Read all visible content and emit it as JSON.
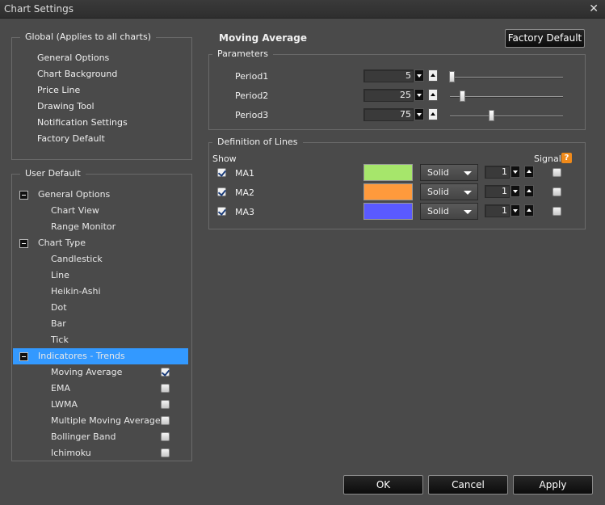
{
  "window": {
    "title": "Chart Settings",
    "close_symbol": "✕"
  },
  "global_section": {
    "legend": "Global (Applies to all charts)",
    "items": [
      "General Options",
      "Chart Background",
      "Price Line",
      "Drawing Tool",
      "Notification Settings",
      "Factory Default"
    ]
  },
  "user_default": {
    "legend": "User Default",
    "tree": [
      {
        "label": "General Options"
      },
      {
        "label": "Chart View"
      },
      {
        "label": "Range Monitor"
      },
      {
        "label": "Chart Type"
      },
      {
        "label": "Candlestick"
      },
      {
        "label": "Line"
      },
      {
        "label": "Heikin-Ashi"
      },
      {
        "label": "Dot"
      },
      {
        "label": "Bar"
      },
      {
        "label": "Tick"
      },
      {
        "label": "Indicatores - Trends"
      },
      {
        "label": "Moving Average",
        "checked": true
      },
      {
        "label": "EMA",
        "checked": false
      },
      {
        "label": "LWMA",
        "checked": false
      },
      {
        "label": "Multiple Moving Averages",
        "checked": false
      },
      {
        "label": "Bollinger Band",
        "checked": false
      },
      {
        "label": "Ichimoku",
        "checked": false
      }
    ]
  },
  "panel": {
    "title": "Moving Average",
    "factory_default_button": "Factory Default"
  },
  "parameters": {
    "legend": "Parameters",
    "items": [
      {
        "label": "Period1",
        "value": "5",
        "level": 0.03
      },
      {
        "label": "Period2",
        "value": "25",
        "level": 0.11
      },
      {
        "label": "Period3",
        "value": "75",
        "level": 0.37
      }
    ]
  },
  "lines": {
    "legend": "Definition of Lines",
    "show_header": "Show",
    "signal_header": "Signal",
    "help_symbol": "?",
    "rows": [
      {
        "name": "MA1",
        "show": true,
        "color": "#a6e66b",
        "style": "Solid",
        "width": "1",
        "signal": false
      },
      {
        "name": "MA2",
        "show": true,
        "color": "#ff9a3c",
        "style": "Solid",
        "width": "1",
        "signal": false
      },
      {
        "name": "MA3",
        "show": true,
        "color": "#5a5aff",
        "style": "Solid",
        "width": "1",
        "signal": false
      }
    ]
  },
  "footer": {
    "ok": "OK",
    "cancel": "Cancel",
    "apply": "Apply"
  },
  "colors": {
    "selection": "#3399ff",
    "background": "#4a4a4a",
    "help": "#f08a1a"
  }
}
